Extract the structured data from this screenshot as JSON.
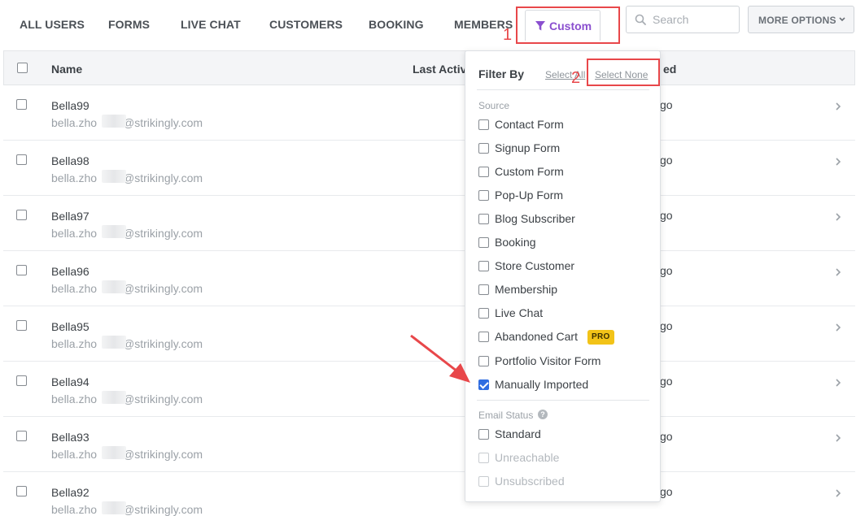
{
  "tabs": [
    {
      "label": "ALL USERS"
    },
    {
      "label": "FORMS"
    },
    {
      "label": "LIVE CHAT"
    },
    {
      "label": "CUSTOMERS"
    },
    {
      "label": "BOOKING"
    },
    {
      "label": "MEMBERS"
    }
  ],
  "custom_tab": {
    "label": "Custom",
    "icon": "filter-icon",
    "color": "#8a4fcf"
  },
  "search": {
    "placeholder": "Search"
  },
  "more_options": {
    "label": "MORE OPTIONS"
  },
  "table": {
    "headers": {
      "name": "Name",
      "last_active": "Last Activ",
      "added": "ed"
    },
    "rows": [
      {
        "name": "Bella99",
        "email_prefix": "bella.zho",
        "email_domain": "@strikingly.com",
        "added": "go"
      },
      {
        "name": "Bella98",
        "email_prefix": "bella.zho",
        "email_domain": "@strikingly.com",
        "added": "go"
      },
      {
        "name": "Bella97",
        "email_prefix": "bella.zho",
        "email_domain": "@strikingly.com",
        "added": "go"
      },
      {
        "name": "Bella96",
        "email_prefix": "bella.zho",
        "email_domain": "@strikingly.com",
        "added": "go"
      },
      {
        "name": "Bella95",
        "email_prefix": "bella.zho",
        "email_domain": "@strikingly.com",
        "added": "go"
      },
      {
        "name": "Bella94",
        "email_prefix": "bella.zho",
        "email_domain": "@strikingly.com",
        "added": "go"
      },
      {
        "name": "Bella93",
        "email_prefix": "bella.zho",
        "email_domain": "@strikingly.com",
        "added": "go"
      },
      {
        "name": "Bella92",
        "email_prefix": "bella.zho",
        "email_domain": "@strikingly.com",
        "added": "go"
      }
    ]
  },
  "filter": {
    "title": "Filter By",
    "select_all": "Select All",
    "select_none": "Select None",
    "source_label": "Source",
    "source_items": [
      {
        "label": "Contact Form",
        "checked": false
      },
      {
        "label": "Signup Form",
        "checked": false
      },
      {
        "label": "Custom Form",
        "checked": false
      },
      {
        "label": "Pop-Up Form",
        "checked": false
      },
      {
        "label": "Blog Subscriber",
        "checked": false
      },
      {
        "label": "Booking",
        "checked": false
      },
      {
        "label": "Store Customer",
        "checked": false
      },
      {
        "label": "Membership",
        "checked": false
      },
      {
        "label": "Live Chat",
        "checked": false
      },
      {
        "label": "Abandoned Cart",
        "checked": false,
        "badge": "PRO"
      },
      {
        "label": "Portfolio Visitor Form",
        "checked": false
      },
      {
        "label": "Manually Imported",
        "checked": true
      }
    ],
    "email_status_label": "Email Status",
    "email_status_items": [
      {
        "label": "Standard",
        "checked": false,
        "disabled": false
      },
      {
        "label": "Unreachable",
        "checked": false,
        "disabled": true
      },
      {
        "label": "Unsubscribed",
        "checked": false,
        "disabled": true
      }
    ]
  },
  "annotations": {
    "step1": "1",
    "step2": "2",
    "color": "#e8474a"
  }
}
